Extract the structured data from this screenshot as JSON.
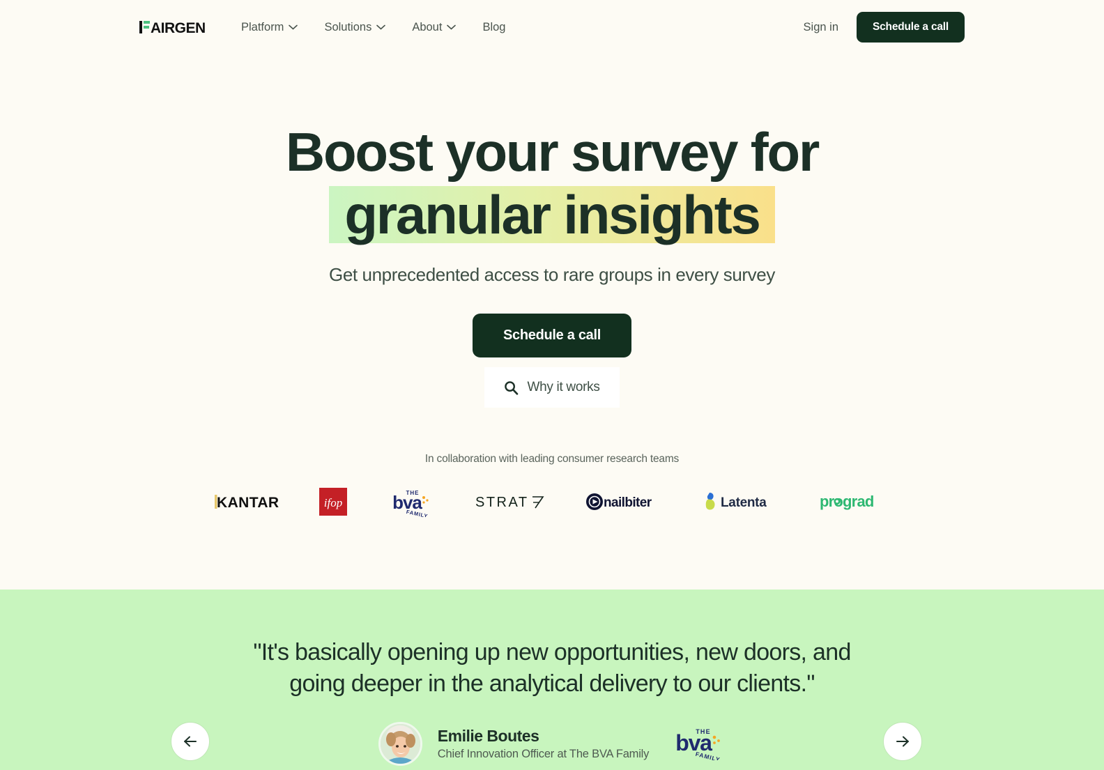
{
  "header": {
    "logo_text": "FAIRGEN",
    "nav": [
      {
        "label": "Platform",
        "has_dropdown": true
      },
      {
        "label": "Solutions",
        "has_dropdown": true
      },
      {
        "label": "About",
        "has_dropdown": true
      },
      {
        "label": "Blog",
        "has_dropdown": false
      }
    ],
    "signin_label": "Sign in",
    "cta_label": "Schedule a call"
  },
  "hero": {
    "headline_line1": "Boost your survey for",
    "headline_highlight": "granular insights",
    "subtitle": "Get unprecedented access to rare groups in every survey",
    "cta_primary": "Schedule a call",
    "cta_secondary": "Why it works",
    "secondary_icon": "search-icon",
    "collab_text": "In collaboration with leading consumer research teams",
    "partners": [
      {
        "name": "KANTAR"
      },
      {
        "name": "ifop"
      },
      {
        "name": "THE bva FAMILY"
      },
      {
        "name": "STRAT 7"
      },
      {
        "name": "nailbiter"
      },
      {
        "name": "Latenta"
      },
      {
        "name": "prograd"
      }
    ]
  },
  "testimonial": {
    "quote": "\"It's basically opening up new opportunities, new doors, and going deeper in the analytical delivery to our clients.\"",
    "author_name": "Emilie Boutes",
    "author_role": "Chief Innovation Officer at The BVA Family",
    "company_logo": "THE bva FAMILY",
    "prev_label": "Previous testimonial",
    "next_label": "Next testimonial"
  },
  "colors": {
    "page_background": "#FDFBF4",
    "dark_green": "#12301F",
    "testimonial_background": "#C8F5BE",
    "highlight_from": "#CBF5C2",
    "highlight_to": "#FAE08A",
    "accent_green": "#3BAF6E"
  }
}
